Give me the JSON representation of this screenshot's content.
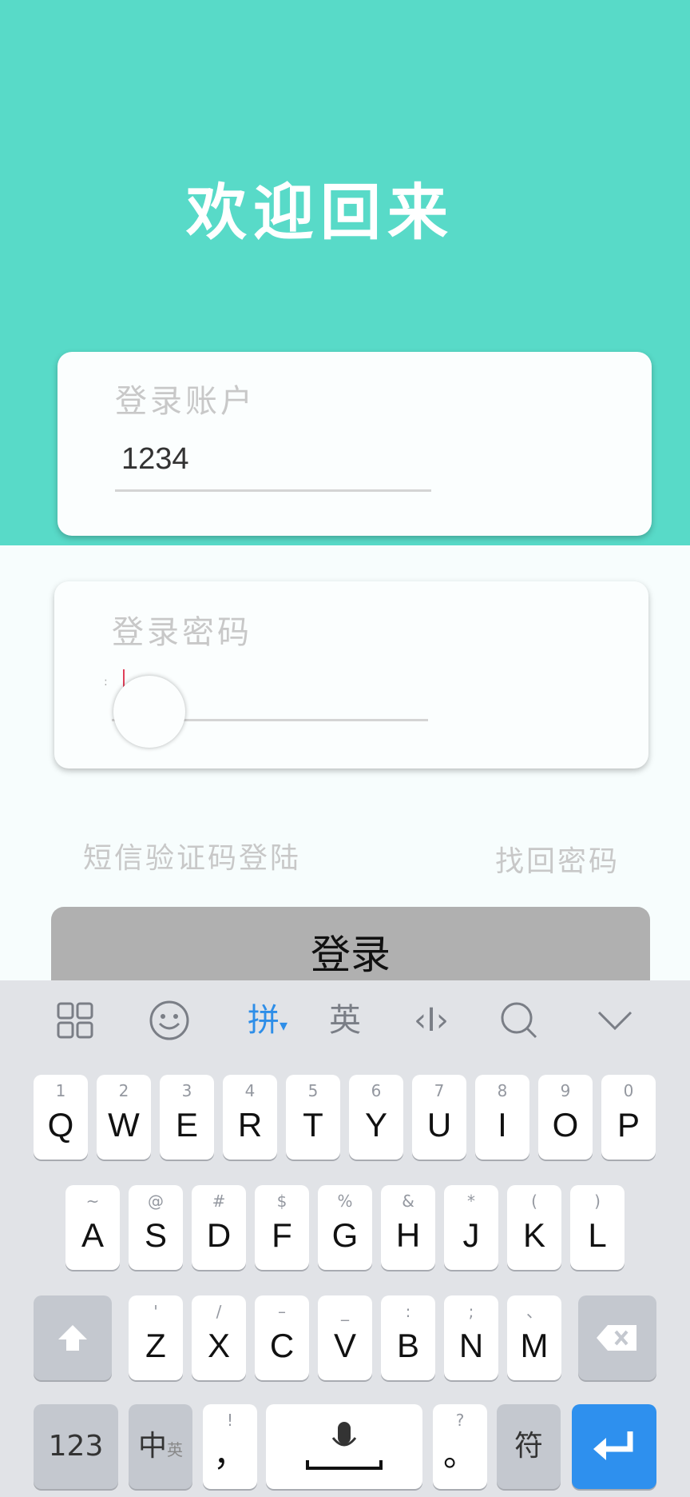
{
  "header": {
    "title": "欢迎回来"
  },
  "account": {
    "label": "登录账户",
    "value": "1234"
  },
  "password": {
    "label": "登录密码",
    "value": ""
  },
  "links": {
    "sms_login": "短信验证码登陆",
    "forgot": "找回密码"
  },
  "login_button": "登录",
  "keyboard": {
    "toolbar": {
      "grid_icon": "grid-icon",
      "emoji_icon": "emoji-icon",
      "pinyin": "拼",
      "english": "英",
      "cursor": "‹I›",
      "search_icon": "search-icon",
      "collapse_icon": "chevron-down-icon"
    },
    "row1": [
      {
        "main": "Q",
        "sub": "1"
      },
      {
        "main": "W",
        "sub": "2"
      },
      {
        "main": "E",
        "sub": "3"
      },
      {
        "main": "R",
        "sub": "4"
      },
      {
        "main": "T",
        "sub": "5"
      },
      {
        "main": "Y",
        "sub": "6"
      },
      {
        "main": "U",
        "sub": "7"
      },
      {
        "main": "I",
        "sub": "8"
      },
      {
        "main": "O",
        "sub": "9"
      },
      {
        "main": "P",
        "sub": "0"
      }
    ],
    "row2": [
      {
        "main": "A",
        "sub": "~"
      },
      {
        "main": "S",
        "sub": "@"
      },
      {
        "main": "D",
        "sub": "#"
      },
      {
        "main": "F",
        "sub": "$"
      },
      {
        "main": "G",
        "sub": "%"
      },
      {
        "main": "H",
        "sub": "&"
      },
      {
        "main": "J",
        "sub": "*"
      },
      {
        "main": "K",
        "sub": "("
      },
      {
        "main": "L",
        "sub": ")"
      }
    ],
    "row3": [
      {
        "main": "Z",
        "sub": "'"
      },
      {
        "main": "X",
        "sub": "/"
      },
      {
        "main": "C",
        "sub": "–"
      },
      {
        "main": "V",
        "sub": "_"
      },
      {
        "main": "B",
        "sub": ":"
      },
      {
        "main": "N",
        "sub": ";"
      },
      {
        "main": "M",
        "sub": "、"
      }
    ],
    "bottom": {
      "num": "123",
      "lang": "中",
      "lang_sub": "英",
      "comma_sub": "!",
      "comma": "，",
      "period_sub": "?",
      "period": "。",
      "symbol": "符"
    }
  }
}
